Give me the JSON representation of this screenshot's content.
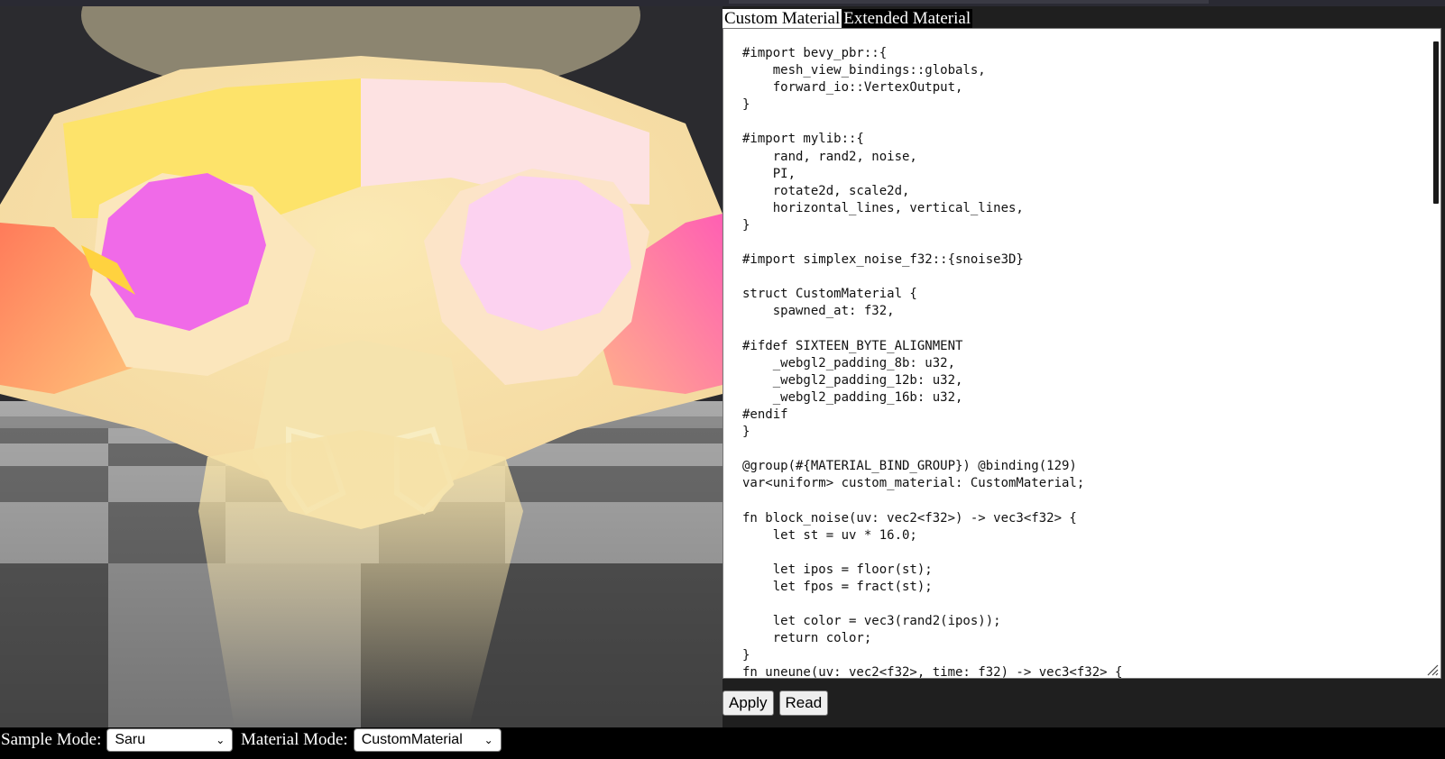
{
  "tabs": [
    {
      "label": "Custom Material",
      "active": true
    },
    {
      "label": "Extended Material",
      "active": false
    }
  ],
  "editor": {
    "code": "#import bevy_pbr::{\n    mesh_view_bindings::globals,\n    forward_io::VertexOutput,\n}\n\n#import mylib::{\n    rand, rand2, noise,\n    PI,\n    rotate2d, scale2d,\n    horizontal_lines, vertical_lines,\n}\n\n#import simplex_noise_f32::{snoise3D}\n\nstruct CustomMaterial {\n    spawned_at: f32,\n\n#ifdef SIXTEEN_BYTE_ALIGNMENT\n    _webgl2_padding_8b: u32,\n    _webgl2_padding_12b: u32,\n    _webgl2_padding_16b: u32,\n#endif\n}\n\n@group(#{MATERIAL_BIND_GROUP}) @binding(129)\nvar<uniform> custom_material: CustomMaterial;\n\nfn block_noise(uv: vec2<f32>) -> vec3<f32> {\n    let st = uv * 16.0;\n\n    let ipos = floor(st);\n    let fpos = fract(st);\n\n    let color = vec3(rand2(ipos));\n    return color;\n}\nfn uneune(uv: vec2<f32>, time: f32) -> vec3<f32> {"
  },
  "buttons": {
    "apply": "Apply",
    "read": "Read"
  },
  "controls": {
    "sample_mode_label": "Sample Mode:",
    "sample_mode_value": "Saru",
    "material_mode_label": "Material Mode:",
    "material_mode_value": "CustomMaterial"
  },
  "icons": {
    "dropdown": "chevron-down-icon",
    "resize": "resize-grip-icon"
  },
  "colors": {
    "background": "#1f1f1f",
    "viewport_sky": "#2b2b2f",
    "editor_bg": "#ffffff",
    "accent_pink": "#f06ae8",
    "accent_yellow": "#fde36a"
  }
}
